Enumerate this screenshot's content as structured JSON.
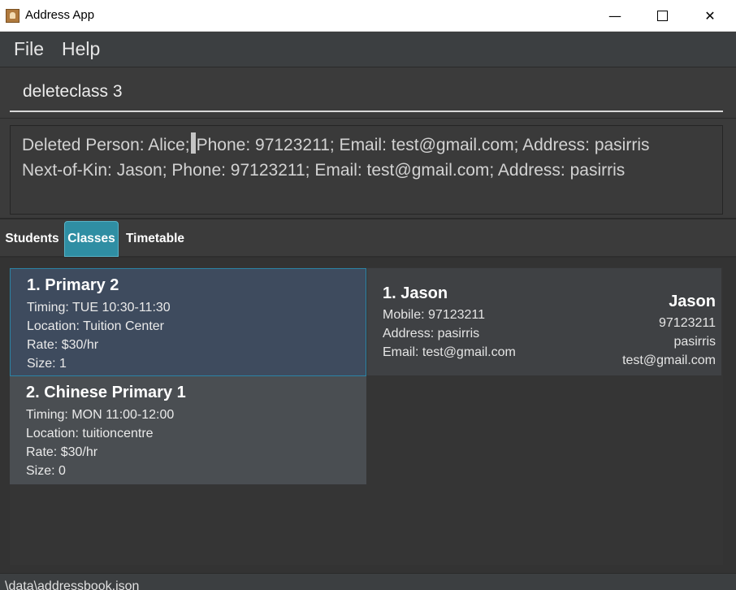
{
  "window": {
    "title": "Address App",
    "min_glyph": "—",
    "close_glyph": "✕"
  },
  "menu": {
    "file": "File",
    "help": "Help"
  },
  "command": {
    "value": "deleteclass 3"
  },
  "result": {
    "line1_before_caret": "Deleted Person: Alice;",
    "line1_after_caret": "Phone: 97123211; Email: test@gmail.com; Address: pasirris",
    "line2": "Next-of-Kin: Jason; Phone: 97123211; Email: test@gmail.com; Address: pasirris"
  },
  "tabs": [
    {
      "label": "Students",
      "active": false
    },
    {
      "label": "Classes",
      "active": true
    },
    {
      "label": "Timetable",
      "active": false
    }
  ],
  "classes": [
    {
      "title": "1.  Primary 2",
      "timing": "Timing: TUE 10:30-11:30",
      "location": "Location: Tuition Center",
      "rate": "Rate: $30/hr",
      "size": "Size: 1",
      "selected": true
    },
    {
      "title": "2.  Chinese Primary 1",
      "timing": "Timing: MON 11:00-12:00",
      "location": "Location: tuitioncentre",
      "rate": "Rate: $30/hr",
      "size": "Size: 0",
      "selected": false
    }
  ],
  "student": {
    "title": "1.  Jason",
    "mobile": "Mobile: 97123211",
    "address": "Address: pasirris",
    "email": "Email: test@gmail.com",
    "nok_name": "Jason",
    "nok_phone": "97123211",
    "nok_address": "pasirris",
    "nok_email": "test@gmail.com"
  },
  "status": {
    "path": "\\data\\addressbook.json"
  },
  "colors": {
    "accent_tab": "#2f8ea3",
    "selected_card": "#3e4b5e",
    "card": "#4a4e52",
    "background": "#333333"
  }
}
